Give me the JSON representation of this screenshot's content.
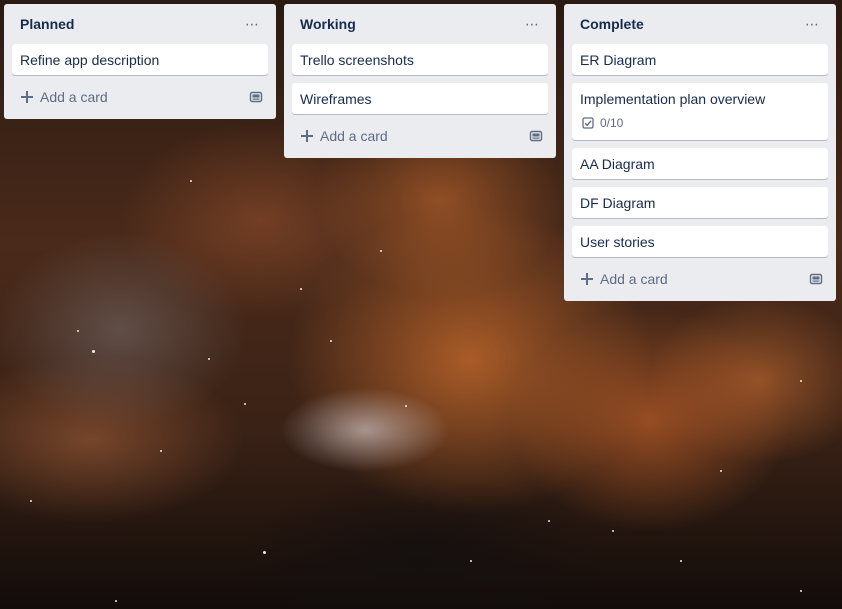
{
  "lists": [
    {
      "title": "Planned",
      "cards": [
        {
          "title": "Refine app description"
        }
      ],
      "add_card_label": "Add a card"
    },
    {
      "title": "Working",
      "cards": [
        {
          "title": "Trello screenshots"
        },
        {
          "title": "Wireframes"
        }
      ],
      "add_card_label": "Add a card"
    },
    {
      "title": "Complete",
      "cards": [
        {
          "title": "ER Diagram"
        },
        {
          "title": "Implementation plan overview",
          "checklist": "0/10"
        },
        {
          "title": "AA Diagram"
        },
        {
          "title": "DF Diagram"
        },
        {
          "title": "User stories"
        }
      ],
      "add_card_label": "Add a card"
    }
  ],
  "list_menu_glyph": "⋯",
  "colors": {
    "list_bg": "#ebecf0",
    "card_bg": "#ffffff",
    "title_text": "#172b4d",
    "muted_text": "#5e6c84"
  },
  "icons": {
    "list_menu": "more-horizontal-icon",
    "add": "plus-icon",
    "template": "card-template-icon",
    "checklist": "checklist-icon"
  }
}
